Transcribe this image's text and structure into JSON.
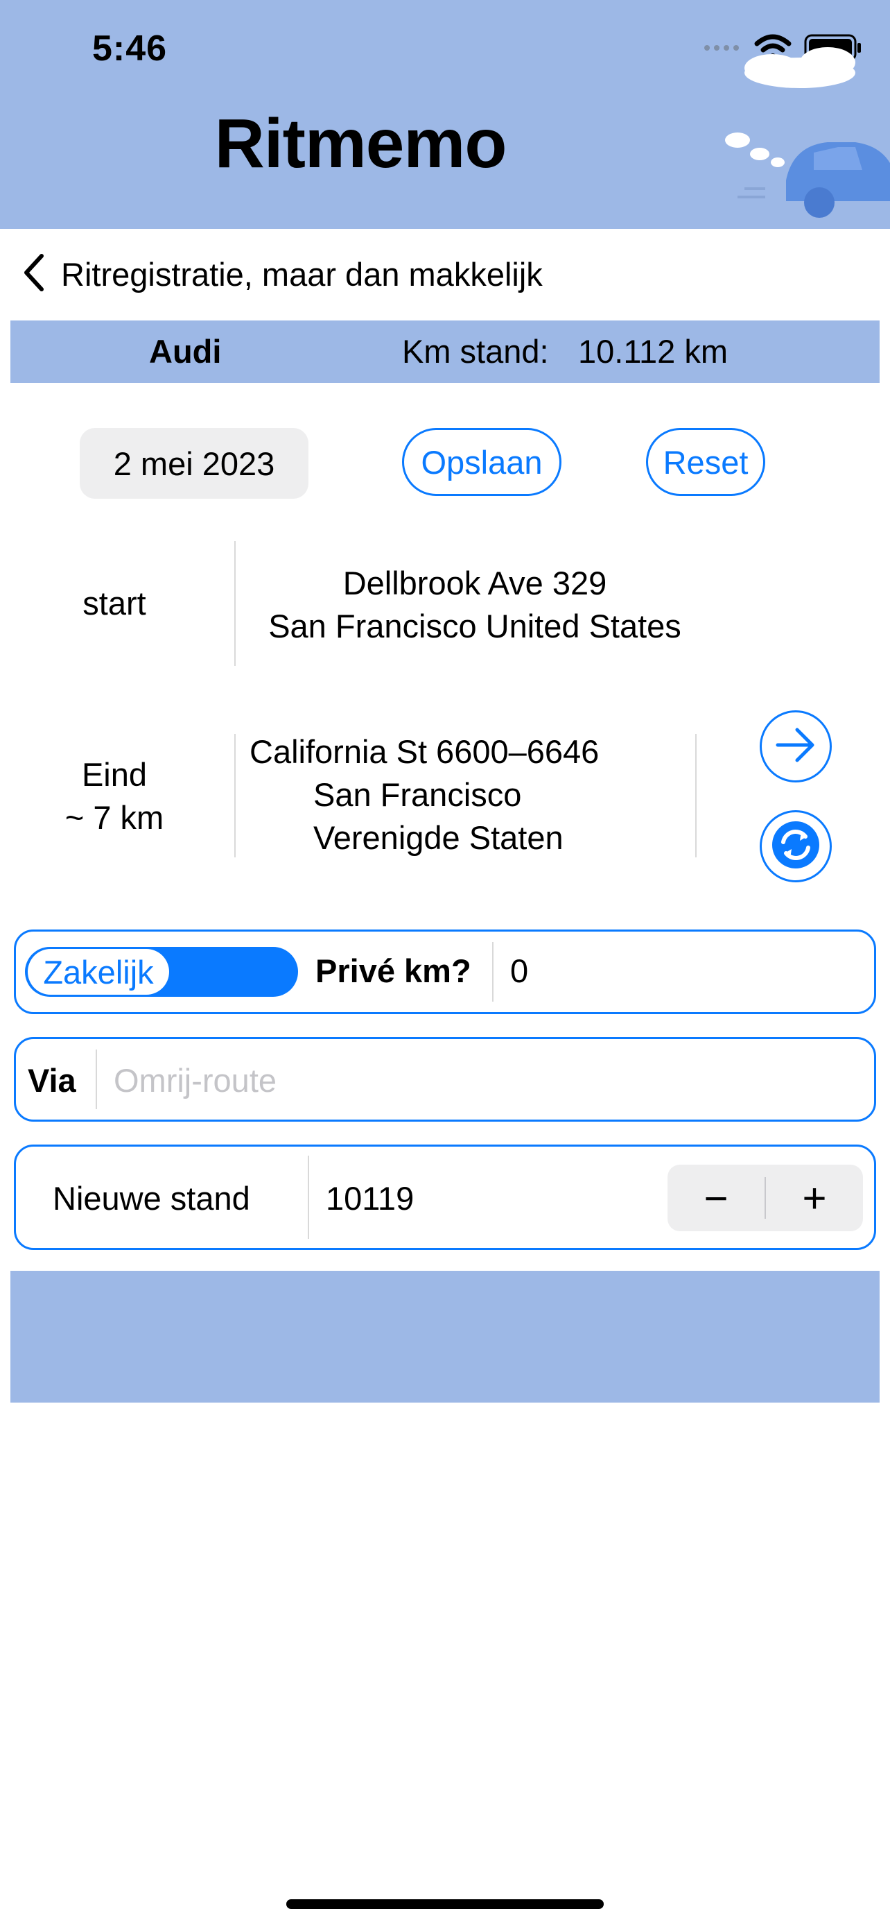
{
  "status_bar": {
    "time": "5:46"
  },
  "app": {
    "title": "Ritmemo"
  },
  "nav": {
    "back_label": "Ritregistratie, maar dan makkelijk",
    "back_icon": "chevron-left-icon"
  },
  "vehicle": {
    "name": "Audi",
    "km_label": "Km stand:",
    "km_value": "10.112 km"
  },
  "actions": {
    "date": "2 mei 2023",
    "save_label": "Opslaan",
    "reset_label": "Reset"
  },
  "start": {
    "label": "start",
    "address_line1": "Dellbrook Ave 329",
    "address_line2": "San Francisco United States"
  },
  "end": {
    "label": "Eind",
    "distance": "~ 7 km",
    "address_line1": "California St 6600–6646",
    "address_line2": "San Francisco",
    "address_line3": "Verenigde Staten"
  },
  "trip_type": {
    "toggle_label": "Zakelijk",
    "private_label": "Privé km?",
    "private_value": "0"
  },
  "via": {
    "label": "Via",
    "placeholder": "Omrij-route"
  },
  "odometer": {
    "label": "Nieuwe stand",
    "value": "10119",
    "minus": "−",
    "plus": "+"
  },
  "colors": {
    "accent": "#0a7aff",
    "band": "#9db8e6",
    "button_gray": "#eeeeef"
  }
}
